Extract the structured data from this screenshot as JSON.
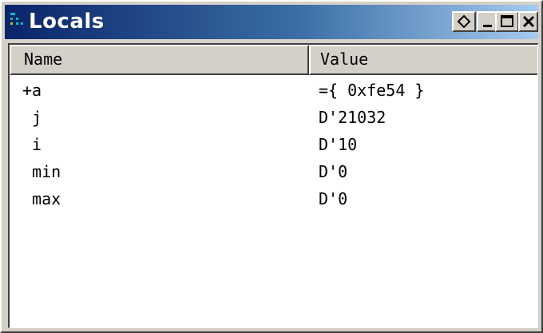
{
  "window": {
    "title": "Locals",
    "title_icon": "locals-window-icon",
    "controls": {
      "diamond": "restore-diamond-icon",
      "minimize": "minimize-icon",
      "maximize": "maximize-icon",
      "close": "close-icon"
    }
  },
  "colors": {
    "title_start": "#0a246a",
    "title_end": "#a6caf0",
    "face": "#d4d0c8"
  },
  "table": {
    "columns": [
      "Name",
      "Value"
    ],
    "rows": [
      {
        "name": "+a",
        "value": "={ 0xfe54 }"
      },
      {
        "name": " j",
        "value": "D'21032"
      },
      {
        "name": " i",
        "value": "D'10"
      },
      {
        "name": " min",
        "value": "D'0"
      },
      {
        "name": " max",
        "value": "D'0"
      }
    ]
  }
}
